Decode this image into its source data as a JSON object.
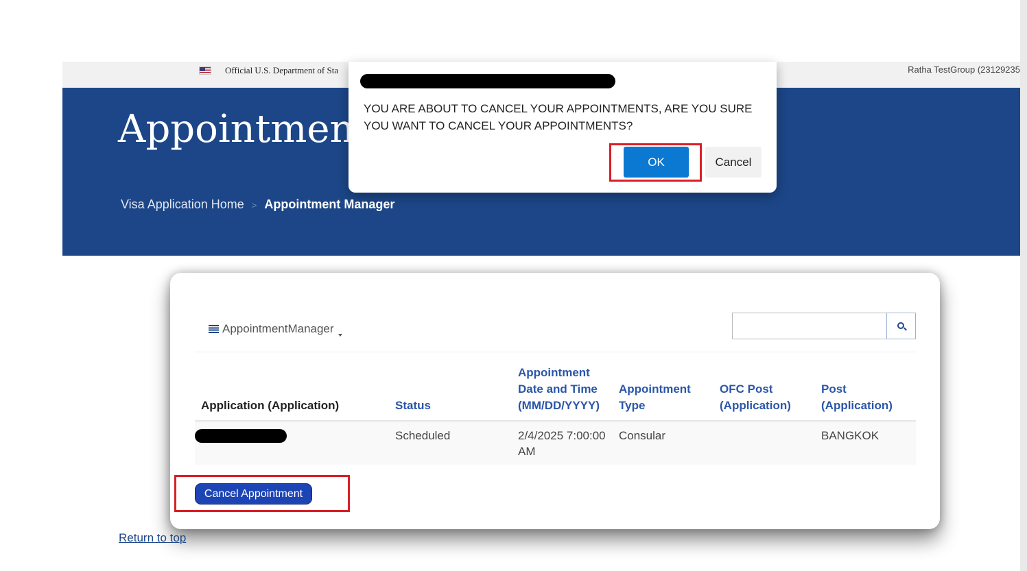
{
  "gov_banner": {
    "text": "Official U.S. Department of Sta",
    "user": "Ratha TestGroup (23129235"
  },
  "hero": {
    "title": "Appointment",
    "breadcrumb": {
      "home": "Visa Application Home",
      "separator": ">",
      "current": "Appointment Manager"
    }
  },
  "toolbar": {
    "menu_label": "AppointmentManager",
    "search": {
      "value": "",
      "placeholder": ""
    }
  },
  "table": {
    "headers": [
      "Application (Application)",
      "Status",
      "Appointment Date and Time (MM/DD/YYYY)",
      "Appointment Type",
      "OFC Post (Application)",
      "Post (Application)"
    ],
    "rows": [
      {
        "application": "",
        "status": "Scheduled",
        "date_time": "2/4/2025 7:00:00 AM",
        "type": "Consular",
        "ofc_post": "",
        "post": "BANGKOK"
      }
    ]
  },
  "actions": {
    "cancel_appointment": "Cancel Appointment"
  },
  "footer": {
    "return_to_top": "Return to top"
  },
  "dialog": {
    "message": "YOU ARE ABOUT TO CANCEL YOUR APPOINTMENTS, ARE YOU SURE YOU WANT TO CANCEL YOUR APPOINTMENTS?",
    "ok": "OK",
    "cancel": "Cancel"
  },
  "colors": {
    "hero_blue": "#1c4687",
    "link_blue": "#2b56a8",
    "primary_button": "#0b78d1",
    "cancel_appointment_button": "#1d44b4",
    "highlight_red": "#d81f26"
  },
  "icons": {
    "flag": "us-flag-icon",
    "menu": "list-icon",
    "dropdown": "caret-down-icon",
    "search": "search-icon"
  }
}
